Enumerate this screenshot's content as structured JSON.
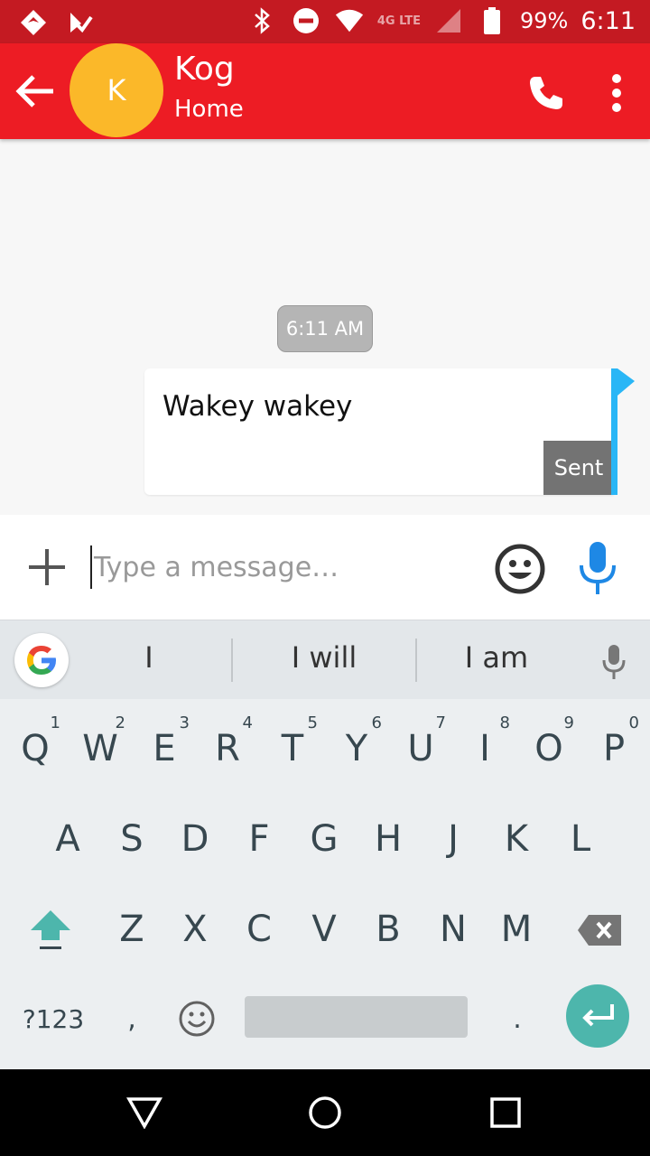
{
  "status_bar": {
    "battery_percent": "99%",
    "time": "6:11",
    "network": "4G LTE"
  },
  "header": {
    "avatar_letter": "K",
    "contact_name": "Kog",
    "contact_subtitle": "Home",
    "accent_color": "#ed1c24"
  },
  "conversation": {
    "timestamp": "6:11 AM",
    "messages": [
      {
        "text": "Wakey wakey",
        "status": "Sent"
      }
    ]
  },
  "composer": {
    "placeholder": "Type a message…"
  },
  "suggestions": [
    "I",
    "I will",
    "I am"
  ],
  "keyboard": {
    "row1": [
      {
        "key": "Q",
        "hint": "1"
      },
      {
        "key": "W",
        "hint": "2"
      },
      {
        "key": "E",
        "hint": "3"
      },
      {
        "key": "R",
        "hint": "4"
      },
      {
        "key": "T",
        "hint": "5"
      },
      {
        "key": "Y",
        "hint": "6"
      },
      {
        "key": "U",
        "hint": "7"
      },
      {
        "key": "I",
        "hint": "8"
      },
      {
        "key": "O",
        "hint": "9"
      },
      {
        "key": "P",
        "hint": "0"
      }
    ],
    "row2": [
      "A",
      "S",
      "D",
      "F",
      "G",
      "H",
      "J",
      "K",
      "L"
    ],
    "row3": [
      "Z",
      "X",
      "C",
      "V",
      "B",
      "N",
      "M"
    ],
    "symbols_label": "?123",
    "comma_label": ",",
    "period_label": "."
  }
}
